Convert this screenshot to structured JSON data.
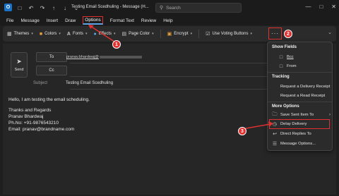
{
  "titlebar": {
    "app_icon": "outlook-icon",
    "quick_access": [
      "save-icon",
      "undo-icon",
      "redo-icon",
      "up-icon",
      "down-icon",
      "expand-icon"
    ],
    "title": "Testing Email Scedhuling - Message (H...",
    "search_placeholder": "Search",
    "window_controls": [
      "minimize-icon",
      "maximize-icon",
      "close-icon"
    ]
  },
  "menu": [
    "File",
    "Message",
    "Insert",
    "Draw",
    "Options",
    "Format Text",
    "Review",
    "Help"
  ],
  "menu_active": "Options",
  "ribbon": {
    "themes": "Themes",
    "colors": "Colors",
    "fonts": "Fonts",
    "effects": "Effects",
    "page_color": "Page Color",
    "encrypt": "Encrypt",
    "voting": "Use Voting Buttons",
    "more": "···"
  },
  "compose": {
    "send": "Send",
    "to": "To",
    "cc": "Cc",
    "to_value": "pranav.bhardwaj@",
    "subject_label": "Subject",
    "subject_value": "Testing Email Scedhuling"
  },
  "body_lines": [
    "Hello, I am testing the email scheduling.",
    "",
    "Thanks and Regards",
    "Pranav Bhardwaj",
    "Ph.No: +91-9876543210",
    "Email: pranav@brandname.com"
  ],
  "dropdown": {
    "show_fields": "Show Fields",
    "bcc": "Bcc",
    "from": "From",
    "tracking": "Tracking",
    "delivery_receipt": "Request a Delivery Receipt",
    "read_receipt": "Request a Read Receipt",
    "more_options": "More Options",
    "save_sent": "Save Sent Item To",
    "delay": "Delay Delivery",
    "direct_replies": "Direct Replies To",
    "message_options": "Message Options..."
  },
  "callouts": [
    "1",
    "2",
    "3"
  ],
  "colors": {
    "accent_red": "#e03131",
    "accent_blue": "#5ba4e6",
    "background": "#1f1f1f"
  }
}
